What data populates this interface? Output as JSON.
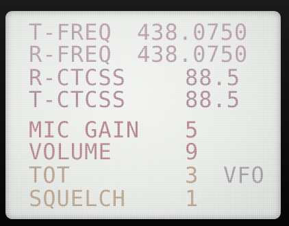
{
  "colors": {
    "bezel": "#0d0d0d",
    "screen": "#e6e9e5",
    "text_row_1": "#b59aa6",
    "text_row_2": "#b39aa8",
    "text_row_3": "#ab8c9a",
    "text_row_4": "#a98795",
    "text_row_5": "#b07e86",
    "text_row_6": "#b08288",
    "text_row_7": "#b69a84",
    "text_row_8": "#b49e86"
  },
  "display": {
    "rows": [
      {
        "label": "T-FREQ",
        "value": "438.0750"
      },
      {
        "label": "R-FREQ",
        "value": "438.0750"
      },
      {
        "label": "R-CTCSS",
        "value": "88.5"
      },
      {
        "label": "T-CTCSS",
        "value": "88.5"
      },
      {
        "label": "MIC GAIN",
        "value": "5"
      },
      {
        "label": "VOLUME",
        "value": "9"
      },
      {
        "label": "TOT",
        "value": "3",
        "mode": "VFO"
      },
      {
        "label": "SQUELCH",
        "value": "1"
      }
    ]
  }
}
